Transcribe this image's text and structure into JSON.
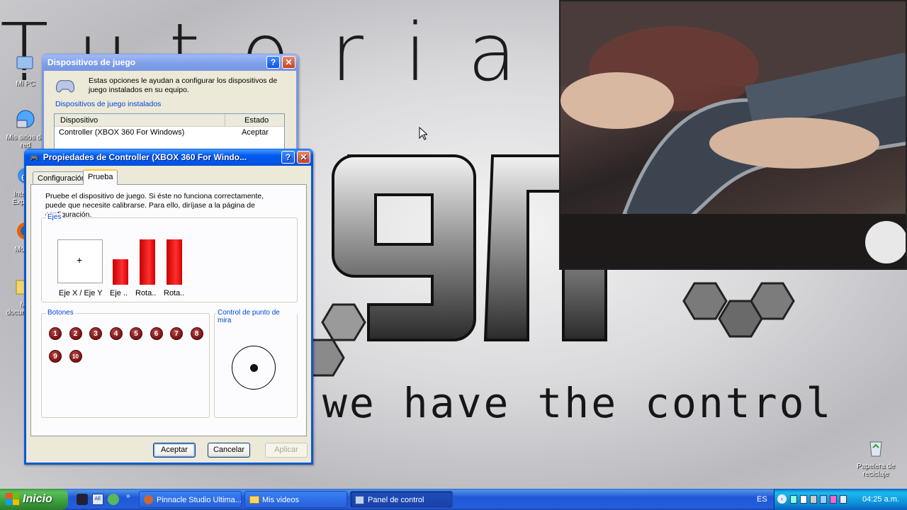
{
  "wallpaper": {
    "top_text": "Tutoria",
    "tagline": "we have the control"
  },
  "desktop_icons": [
    {
      "label": "Mi PC",
      "icon": "computer-icon"
    },
    {
      "label": "Mis sitios de red",
      "icon": "network-icon"
    },
    {
      "label": "Internet Explorer",
      "icon": "ie-icon"
    },
    {
      "label": "Mozilla",
      "icon": "firefox-icon"
    },
    {
      "label": "Mis documentos",
      "icon": "folder-icon"
    },
    {
      "label": "Papelera de reciclaje",
      "icon": "recycle-bin-icon"
    }
  ],
  "game_devices_window": {
    "title": "Dispositivos de juego",
    "description": "Estas opciones le ayudan a configurar los dispositivos de juego instalados en su equipo.",
    "group_label": "Dispositivos de juego instalados",
    "columns": [
      "Dispositivo",
      "Estado"
    ],
    "rows": [
      {
        "device": "Controller (XBOX 360 For Windows)",
        "status": "Aceptar"
      }
    ]
  },
  "properties_window": {
    "title": "Propiedades de Controller (XBOX 360 For Windo...",
    "tabs": [
      {
        "label": "Configuración",
        "active": false
      },
      {
        "label": "Prueba",
        "active": true
      }
    ],
    "instructions": "Pruebe el dispositivo de juego. Si éste no funciona correctamente, puede que necesite calibrarse. Para ello, diríjase a la página de configuración.",
    "axes": {
      "group_label": "Ejes",
      "xy_label": "Eje X / Eje Y",
      "bars": [
        {
          "label": "Eje ..",
          "level": 0.56
        },
        {
          "label": "Rota..",
          "level": 1.0
        },
        {
          "label": "Rota..",
          "level": 1.0
        }
      ]
    },
    "buttons": {
      "group_label": "Botones",
      "items": [
        "1",
        "2",
        "3",
        "4",
        "5",
        "6",
        "7",
        "8",
        "9",
        "10"
      ]
    },
    "pov": {
      "group_label": "Control de punto de mira"
    },
    "footer": {
      "ok": "Aceptar",
      "cancel": "Cancelar",
      "apply": "Aplicar"
    }
  },
  "taskbar": {
    "start_label": "Inicio",
    "tasks": [
      {
        "label": "Pinnacle Studio Ultima...",
        "active": false
      },
      {
        "label": "Mis videos",
        "active": false
      },
      {
        "label": "Panel de control",
        "active": true
      }
    ],
    "language": "ES",
    "clock": "04:25 a.m."
  }
}
